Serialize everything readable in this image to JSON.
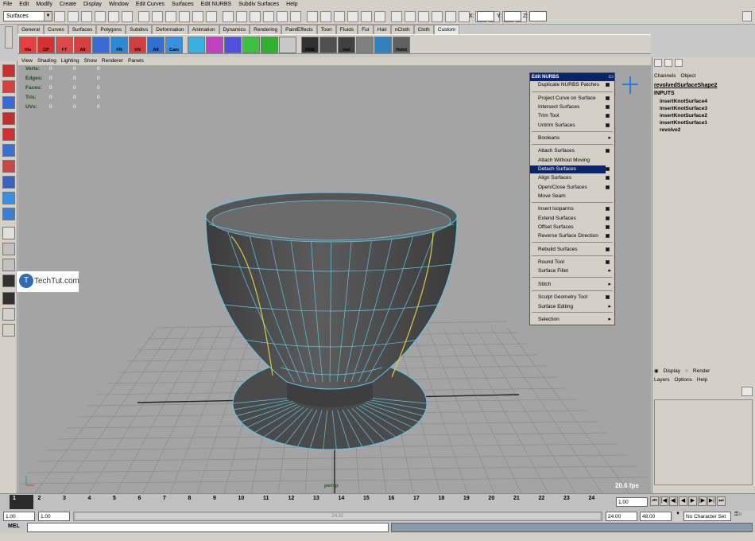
{
  "main_menu": [
    "File",
    "Edit",
    "Modify",
    "Create",
    "Display",
    "Window",
    "Edit Curves",
    "Surfaces",
    "Edit NURBS",
    "Subdiv Surfaces",
    "Help"
  ],
  "status_line": {
    "menu_set": "Surfaces",
    "x_label": "X:",
    "y_label": "Y:",
    "z_label": "Z:"
  },
  "shelf_tabs": [
    "General",
    "Curves",
    "Surfaces",
    "Polygons",
    "Subdivs",
    "Deformation",
    "Animation",
    "Dynamics",
    "Rendering",
    "PaintEffects",
    "Toon",
    "Fluids",
    "Fur",
    "Hair",
    "nCloth",
    "Cloth",
    "Custom"
  ],
  "shelf_buttons": [
    "His",
    "CP",
    "FT",
    "All",
    "",
    "FN",
    "VN",
    "All",
    "Cam",
    "",
    "",
    "",
    "",
    "",
    "",
    "HRB",
    "",
    "mel",
    "",
    "",
    "Hshd"
  ],
  "viewport": {
    "menus": [
      "View",
      "Shading",
      "Lighting",
      "Show",
      "Renderer",
      "Panels"
    ],
    "hud": [
      {
        "label": "Verts:",
        "values": [
          "0",
          "0",
          "0"
        ]
      },
      {
        "label": "Edges:",
        "values": [
          "0",
          "0",
          "0"
        ]
      },
      {
        "label": "Faces:",
        "values": [
          "0",
          "0",
          "0"
        ]
      },
      {
        "label": "Tris:",
        "values": [
          "0",
          "0",
          "0"
        ]
      },
      {
        "label": "UVs:",
        "values": [
          "0",
          "0",
          "0"
        ]
      }
    ],
    "camera": "persp",
    "fps": "20.6 fps"
  },
  "edit_nurbs_menu": {
    "title": "Edit NURBS",
    "items": [
      {
        "label": "Duplicate NURBS Patches",
        "kind": "box"
      },
      {
        "label": "Project Curve on Surface",
        "kind": "box"
      },
      {
        "label": "Intersect Surfaces",
        "kind": "box"
      },
      {
        "label": "Trim Tool",
        "kind": "box"
      },
      {
        "label": "Untrim Surfaces",
        "kind": "box"
      },
      {
        "label": "Booleans",
        "kind": "sub"
      },
      {
        "label": "Attach Surfaces",
        "kind": "box"
      },
      {
        "label": "Attach Without Moving",
        "kind": "none"
      },
      {
        "label": "Detach Surfaces",
        "kind": "box",
        "selected": true
      },
      {
        "label": "Align Surfaces",
        "kind": "box"
      },
      {
        "label": "Open/Close Surfaces",
        "kind": "box"
      },
      {
        "label": "Move Seam",
        "kind": "none"
      },
      {
        "label": "Insert Isoparms",
        "kind": "box"
      },
      {
        "label": "Extend Surfaces",
        "kind": "box"
      },
      {
        "label": "Offset Surfaces",
        "kind": "box"
      },
      {
        "label": "Reverse Surface Direction",
        "kind": "box"
      },
      {
        "label": "Rebuild Surfaces",
        "kind": "box"
      },
      {
        "label": "Round Tool",
        "kind": "box"
      },
      {
        "label": "Surface Fillet",
        "kind": "sub"
      },
      {
        "label": "Stitch",
        "kind": "sub"
      },
      {
        "label": "Sculpt Geometry Tool",
        "kind": "box"
      },
      {
        "label": "Surface Editing",
        "kind": "sub"
      },
      {
        "label": "Selection",
        "kind": "sub"
      }
    ]
  },
  "channel_box": {
    "tabs": [
      "Channels",
      "Object"
    ],
    "node": "revolvedSurfaceShape2",
    "inputs_label": "INPUTS",
    "inputs": [
      "insertKnotSurface4",
      "insertKnotSurface3",
      "insertKnotSurface2",
      "insertKnotSurface1",
      "revolve2"
    ]
  },
  "layer_editor": {
    "display": "Display",
    "render": "Render",
    "menus": [
      "Layers",
      "Options",
      "Help"
    ]
  },
  "time_slider": {
    "ticks": [
      "1",
      "2",
      "3",
      "4",
      "5",
      "6",
      "7",
      "8",
      "9",
      "10",
      "11",
      "12",
      "13",
      "14",
      "15",
      "16",
      "17",
      "18",
      "19",
      "20",
      "21",
      "22",
      "23",
      "24"
    ],
    "current": "1.00"
  },
  "range": {
    "start": "1.00",
    "start2": "1.00",
    "mid": "24.00",
    "end": "24.00",
    "end2": "48.00",
    "char_set": "No Character Set"
  },
  "command_line": {
    "label": "MEL"
  },
  "watermark": "TechTut.com",
  "colors": {
    "menu_highlight": "#0a246a",
    "viewport_bg": "#a4a4a4",
    "wireframe": "#5fc8e8",
    "isoparm_yellow": "#d8d040"
  }
}
